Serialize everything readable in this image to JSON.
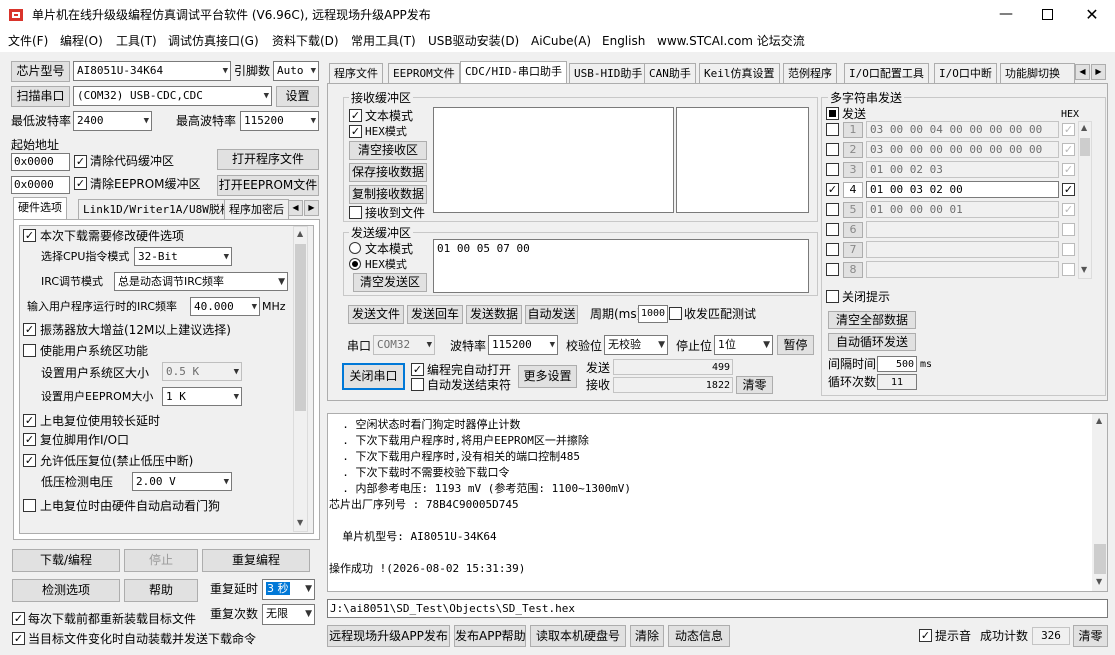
{
  "window": {
    "title": "单片机在线升级级编程仿真调试平台软件 (V6.96C), 远程现场升级APP发布"
  },
  "menu": [
    "文件(F)",
    "编程(O)",
    "工具(T)",
    "调试仿真接口(G)",
    "资料下载(D)",
    "常用工具(T)",
    "USB驱动安装(D)",
    "AiCube(A)",
    "English",
    "www.STCAI.com 论坛交流"
  ],
  "left": {
    "chip_label": "芯片型号",
    "chip_value": "AI8051U-34K64",
    "pins_label": "引脚数",
    "pins_value": "Auto",
    "scan_label": "扫描串口",
    "port_value": "(COM32) USB-CDC,CDC",
    "settings_label": "设置",
    "min_baud_label": "最低波特率",
    "min_baud_value": "2400",
    "max_baud_label": "最高波特率",
    "max_baud_value": "115200",
    "start_addr_label": "起始地址",
    "addr1_value": "0x0000",
    "clear_code_label": "清除代码缓冲区",
    "open_prog_label": "打开程序文件",
    "addr2_value": "0x0000",
    "clear_eeprom_label": "清除EEPROM缓冲区",
    "open_eeprom_label": "打开EEPROM文件",
    "tabs": [
      "硬件选项",
      "Link1D/Writer1A/U8W脱机",
      "程序加密后"
    ],
    "hw": {
      "modify_hw": "本次下载需要修改硬件选项",
      "cpu_mode_label": "选择CPU指令模式",
      "cpu_mode_value": "32-Bit",
      "irc_mode_label": "IRC调节模式",
      "irc_mode_value": "总是动态调节IRC频率",
      "irc_freq_label": "输入用户程序运行时的IRC频率",
      "irc_freq_value": "40.000",
      "irc_freq_unit": "MHz",
      "osc_gain": "振荡器放大增益(12M以上建议选择)",
      "user_sys": "使能用户系统区功能",
      "user_sys_size_label": "设置用户系统区大小",
      "user_sys_size_value": "0.5 K",
      "eeprom_size_label": "设置用户EEPROM大小",
      "eeprom_size_value": "1   K",
      "power_delay": "上电复位使用较长延时",
      "reset_io": "复位脚用作I/O口",
      "lvr": "允许低压复位(禁止低压中断)",
      "lvd_label": "低压检测电压",
      "lvd_value": "2.00 V",
      "wdt": "上电复位时由硬件自动启动看门狗"
    },
    "download_label": "下载/编程",
    "stop_label": "停止",
    "reprogram_label": "重复编程",
    "check_label": "检测选项",
    "help_label": "帮助",
    "repeat_delay_label": "重复延时",
    "repeat_delay_value": "3 秒",
    "repeat_count_label": "重复次数",
    "repeat_count_value": "无限",
    "reload_label": "每次下载前都重新装载目标文件",
    "auto_load_label": "当目标文件变化时自动装载并发送下载命令"
  },
  "right_tabs": [
    "程序文件",
    "EEPROM文件",
    "CDC/HID-串口助手",
    "USB-HID助手",
    "CAN助手",
    "Keil仿真设置",
    "范例程序",
    "I/O口配置工具",
    "I/O口中断",
    "功能脚切换"
  ],
  "serial": {
    "recv_title": "接收缓冲区",
    "text_mode": "文本模式",
    "hex_mode": "HEX模式",
    "clear_recv": "清空接收区",
    "save_recv": "保存接收数据",
    "copy_recv": "复制接收数据",
    "recv_to_file": "接收到文件",
    "send_title": "发送缓冲区",
    "send_text_mode": "文本模式",
    "send_hex_mode": "HEX模式",
    "clear_send": "清空发送区",
    "send_content": "01 00 05 07 00",
    "send_file": "发送文件",
    "send_return": "发送回车",
    "send_data": "发送数据",
    "auto_send": "自动发送",
    "period_label": "周期(ms)",
    "period_value": "1000",
    "match_test": "收发匹配测试",
    "port_label": "串口",
    "port_value": "COM32",
    "baud_label": "波特率",
    "baud_value": "115200",
    "parity_label": "校验位",
    "parity_value": "无校验",
    "stop_label": "停止位",
    "stop_value": "1位",
    "pause_label": "暂停",
    "close_port": "关闭串口",
    "auto_open": "编程完自动打开",
    "auto_end": "自动发送结束符",
    "more_settings": "更多设置",
    "send_count_label": "发送",
    "send_count": "499",
    "recv_count_label": "接收",
    "recv_count": "1822",
    "clear_count": "清零"
  },
  "multi": {
    "title": "多字符串发送",
    "send_header": "发送",
    "hex_header": "HEX",
    "rows": [
      {
        "num": "1",
        "value": "03 00 00 04 00 00 00 00 00",
        "checked": false,
        "hex": true,
        "active": false
      },
      {
        "num": "2",
        "value": "03 00 00 00 00 00 00 00 00",
        "checked": false,
        "hex": true,
        "active": false
      },
      {
        "num": "3",
        "value": "01 00 02 03",
        "checked": false,
        "hex": true,
        "active": false
      },
      {
        "num": "4",
        "value": "01 00 03 02 00",
        "checked": true,
        "hex": true,
        "active": true
      },
      {
        "num": "5",
        "value": "01 00 00 00 01",
        "checked": false,
        "hex": true,
        "active": false
      },
      {
        "num": "6",
        "value": "",
        "checked": false,
        "hex": false,
        "active": false
      },
      {
        "num": "7",
        "value": "",
        "checked": false,
        "hex": false,
        "active": false
      },
      {
        "num": "8",
        "value": "",
        "checked": false,
        "hex": false,
        "active": false
      }
    ],
    "close_hint": "关闭提示",
    "clear_all": "清空全部数据",
    "auto_loop": "自动循环发送",
    "interval_label": "间隔时间",
    "interval_value": "500",
    "interval_unit": "ms",
    "loop_label": "循环次数",
    "loop_value": "11"
  },
  "log": [
    "  . 空闲状态时看门狗定时器停止计数",
    "  . 下次下载用户程序时,将用户EEPROM区一并擦除",
    "  . 下次下载用户程序时,没有相关的端口控制485",
    "  . 下次下载时不需要校验下载口令",
    "  . 内部参考电压: 1193 mV (参考范围: 1100~1300mV)",
    "芯片出厂序列号 : 78B4C90005D745",
    "",
    "  单片机型号: AI8051U-34K64",
    "",
    "操作成功 !(2026-08-02 15:31:39)"
  ],
  "file_path": "J:\\ai8051\\SD_Test\\Objects\\SD_Test.hex",
  "bottom": {
    "publish": "远程现场升级APP发布",
    "publish_help": "发布APP帮助",
    "read_disk": "读取本机硬盘号",
    "clear": "清除",
    "dynamic": "动态信息",
    "beep": "提示音",
    "success_label": "成功计数",
    "success_value": "326",
    "clear_count": "清零"
  }
}
